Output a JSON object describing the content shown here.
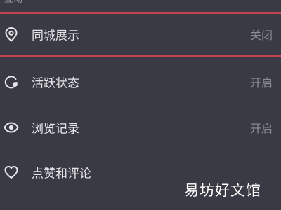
{
  "section": {
    "title": "互动"
  },
  "settings": [
    {
      "label": "同城展示",
      "status": "关闭",
      "icon": "location-pin-icon"
    },
    {
      "label": "活跃状态",
      "status": "开启",
      "icon": "activity-status-icon"
    },
    {
      "label": "浏览记录",
      "status": "开启",
      "icon": "eye-icon"
    },
    {
      "label": "点赞和评论",
      "status": "",
      "icon": "heart-icon"
    }
  ],
  "watermark": "易坊好文馆",
  "colors": {
    "background": "#3a3a44",
    "highlight_border": "#c0454c",
    "label_text": "#e6e6ea",
    "status_text": "#8e8e96"
  }
}
